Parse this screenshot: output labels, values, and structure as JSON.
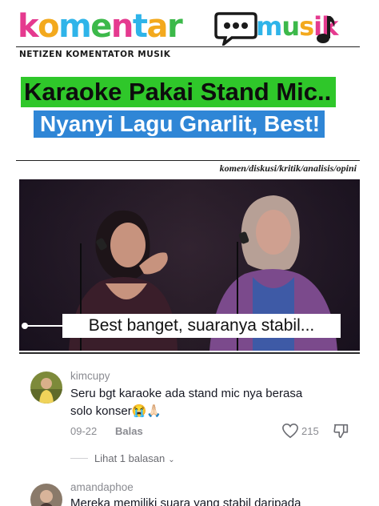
{
  "brand": {
    "name_part1": "komentar",
    "name_part2": "musik",
    "letters1": [
      "k",
      "o",
      "m",
      "e",
      "n",
      "t",
      "a",
      "r"
    ],
    "letter_colors1": [
      "#e53a8f",
      "#f3a91d",
      "#2fb4e9",
      "#3cb94a",
      "#e53a8f",
      "#2fb4e9",
      "#f3a91d",
      "#3cb94a"
    ],
    "letters2": [
      "m",
      "u",
      "s",
      "i",
      "k"
    ],
    "letter_colors2": [
      "#2fb4e9",
      "#3cb94a",
      "#f3a91d",
      "#e53a8f",
      "#e53a8f"
    ],
    "bubble_icon": "speech-bubble-icon",
    "note_icon": "music-note-icon",
    "tagline": "NETIZEN KOMENTATOR MUSIK"
  },
  "headline": {
    "line1": "Karaoke Pakai Stand Mic..",
    "line2": "Nyanyi Lagu Gnarlit, Best!",
    "line1_bg": "#2fc72a",
    "line2_bg": "#2f86d6"
  },
  "subtagline": "komen/diskusi/kritik/analisis/opini",
  "video": {
    "caption": "Best banget, suaranya stabil..."
  },
  "comments": [
    {
      "username": "kimcupy",
      "text_line1": "Seru bgt karaoke ada stand mic nya berasa",
      "text_line2": "solo konser",
      "emoji": "😭🙏🏻",
      "date": "09-22",
      "reply_label": "Balas",
      "likes": "215",
      "view_replies": "Lihat 1 balasan"
    },
    {
      "username": "amandaphoe",
      "text_line1": "Mereka memiliki suara yang stabil daripada"
    }
  ]
}
